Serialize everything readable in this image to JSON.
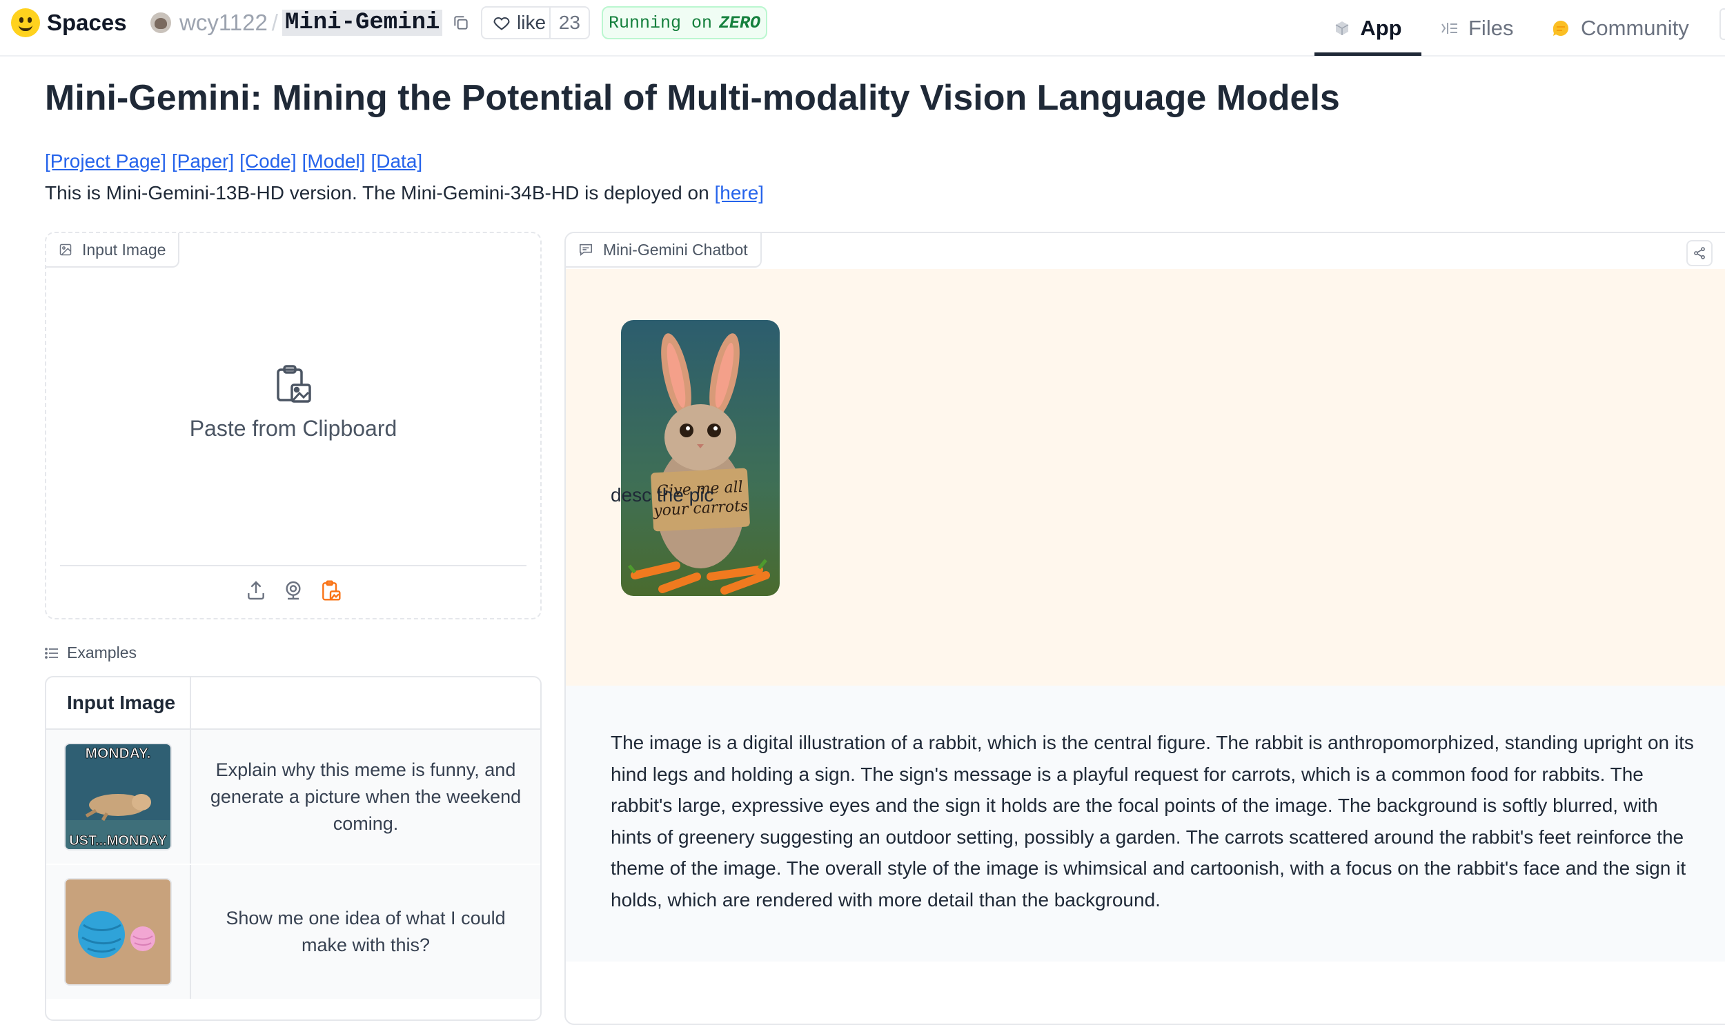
{
  "topbar": {
    "brand": "Spaces",
    "owner": "wcy1122",
    "separator": "/",
    "repo": "Mini-Gemini",
    "like_label": "like",
    "like_count": "23",
    "status_prefix": "Running on",
    "status_hardware": "ZERO",
    "tabs": [
      {
        "label": "App",
        "icon": "cube-icon",
        "active": true
      },
      {
        "label": "Files",
        "icon": "files-icon",
        "active": false
      },
      {
        "label": "Community",
        "icon": "community-icon",
        "active": false
      }
    ]
  },
  "header": {
    "title": "Mini-Gemini: Mining the Potential of Multi-modality Vision Language Models",
    "links": [
      "[Project Page]",
      "[Paper]",
      "[Code]",
      "[Model]",
      "[Data]"
    ],
    "description": "This is Mini-Gemini-13B-HD version. The Mini-Gemini-34B-HD is deployed on ",
    "description_link": "[here]"
  },
  "input_image": {
    "label": "Input Image",
    "paste_text": "Paste from Clipboard",
    "sources": [
      "upload-icon",
      "webcam-icon",
      "clipboard-icon"
    ]
  },
  "examples": {
    "label": "Examples",
    "column_header": "Input Image",
    "rows": [
      {
        "thumb": "monday-meme",
        "thumb_top": "MONDAY.",
        "thumb_bottom": "UST...MONDAY",
        "prompt": "Explain why this meme is funny, and generate a picture when the weekend coming."
      },
      {
        "thumb": "yarn-balls",
        "prompt": "Show me one idea of what I could make with this?"
      }
    ]
  },
  "chatbot": {
    "label": "Mini-Gemini Chatbot",
    "user_image_sign": [
      "Give me all",
      "your carrots"
    ],
    "user_message": "desc the pic",
    "bot_message": "The image is a digital illustration of a rabbit, which is the central figure. The rabbit is anthropomorphized, standing upright on its hind legs and holding a sign. The sign's message is a playful request for carrots, which is a common food for rabbits. The rabbit's large, expressive eyes and the sign it holds are the focal points of the image. The background is softly blurred, with hints of greenery suggesting an outdoor setting, possibly a garden. The carrots scattered around the rabbit's feet reinforce the theme of the image. The overall style of the image is whimsical and cartoonish, with a focus on the rabbit's face and the sign it holds, which are rendered with more detail than the background."
  },
  "colors": {
    "link": "#2563eb",
    "user_bubble": "#fff7ed",
    "bot_bubble": "#f8fafc",
    "status_green": "#15803d",
    "accent_orange": "#f97316"
  }
}
